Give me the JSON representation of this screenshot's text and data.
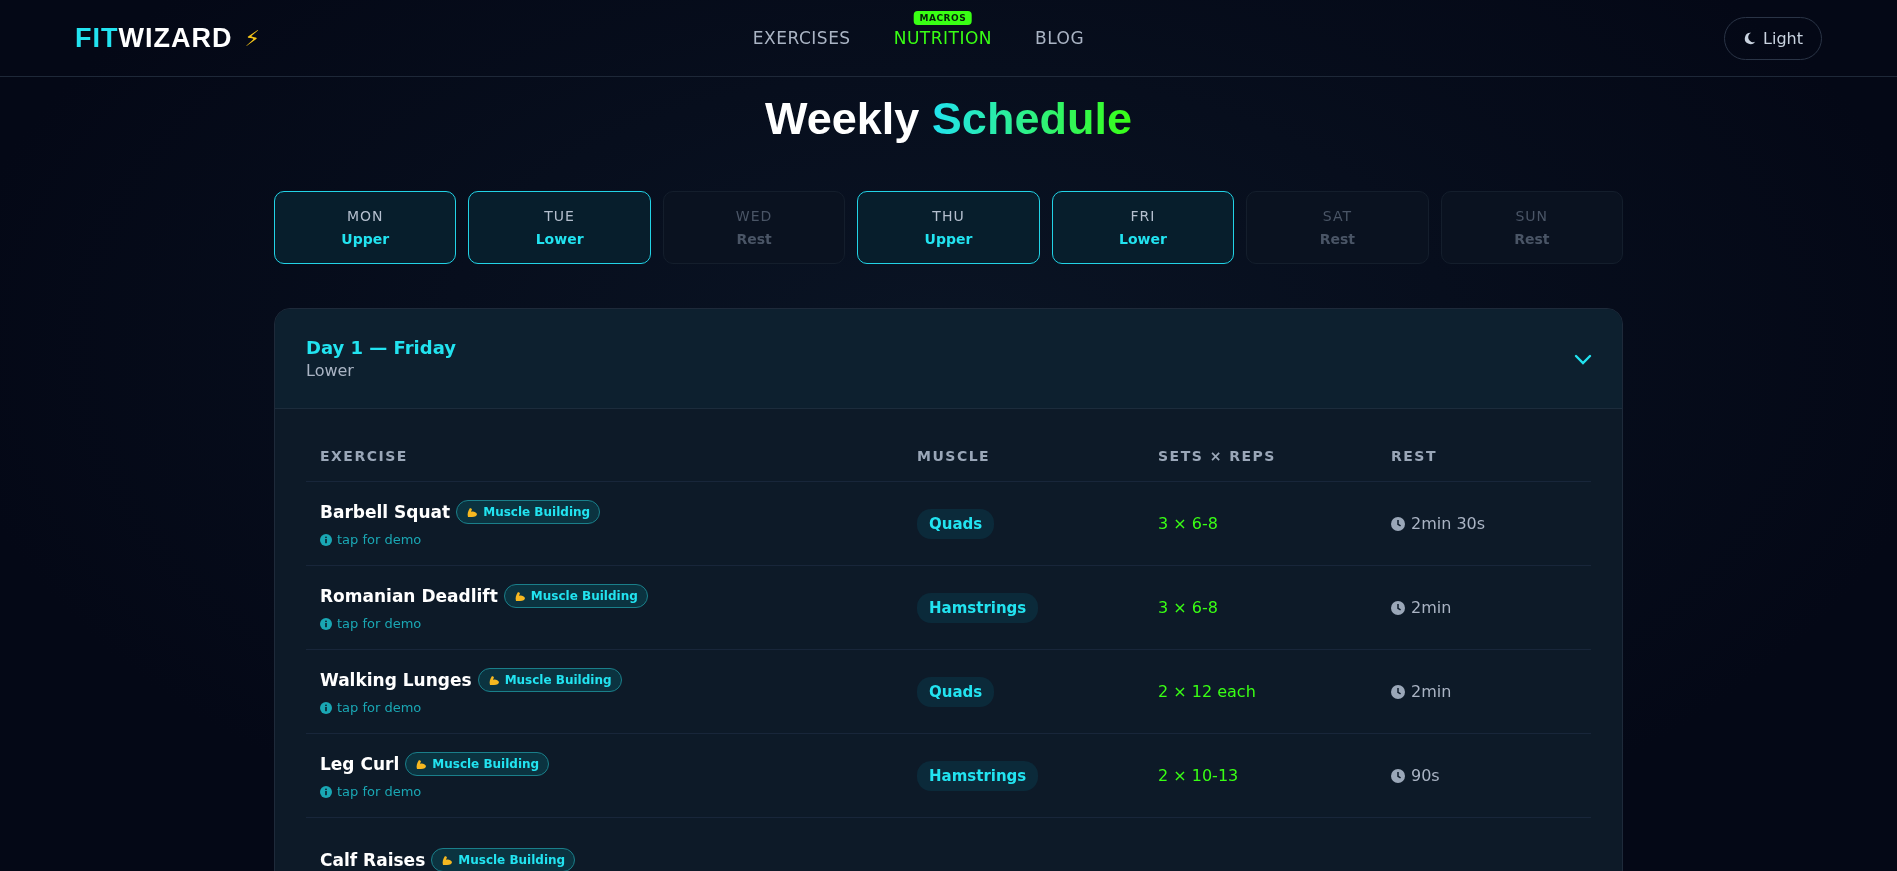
{
  "brand": {
    "part_1": "FIT",
    "part_2": "WIZARD",
    "mark": "⚡"
  },
  "nav": [
    {
      "label": "EXERCISES",
      "selected": false
    },
    {
      "label": "NUTRITION",
      "selected": true,
      "badge": "MACROS"
    },
    {
      "label": "BLOG",
      "selected": false
    }
  ],
  "theme_toggle": {
    "label": "Light"
  },
  "title": {
    "part_1": "Weekly",
    "part_2": "Schedule"
  },
  "days": [
    {
      "day": "MON",
      "workout": "Upper",
      "rest": false
    },
    {
      "day": "TUE",
      "workout": "Lower",
      "rest": false
    },
    {
      "day": "WED",
      "workout": "Rest",
      "rest": true
    },
    {
      "day": "THU",
      "workout": "Upper",
      "rest": false
    },
    {
      "day": "FRI",
      "workout": "Lower",
      "rest": false
    },
    {
      "day": "SAT",
      "workout": "Rest",
      "rest": true
    },
    {
      "day": "SUN",
      "workout": "Rest",
      "rest": true
    }
  ],
  "card": {
    "title": "Day 1 — Friday",
    "subtitle": "Lower",
    "expanded": true
  },
  "table": {
    "columns": [
      "EXERCISE",
      "MUSCLE",
      "SETS × REPS",
      "REST"
    ],
    "rows": [
      {
        "exercise": "Barbell Squat",
        "tag": "Muscle Building",
        "hint": "tap for demo",
        "muscle": "Quads",
        "sets": "3 × 6-8",
        "rest": "2min 30s"
      },
      {
        "exercise": "Romanian Deadlift",
        "tag": "Muscle Building",
        "hint": "tap for demo",
        "muscle": "Hamstrings",
        "sets": "3 × 6-8",
        "rest": "2min"
      },
      {
        "exercise": "Walking Lunges",
        "tag": "Muscle Building",
        "hint": "tap for demo",
        "muscle": "Quads",
        "sets": "2 × 12 each",
        "rest": "2min"
      },
      {
        "exercise": "Leg Curl",
        "tag": "Muscle Building",
        "hint": "tap for demo",
        "muscle": "Hamstrings",
        "sets": "2 × 10-13",
        "rest": "90s"
      },
      {
        "exercise": "Calf Raises",
        "tag": "Muscle Building"
      }
    ]
  }
}
